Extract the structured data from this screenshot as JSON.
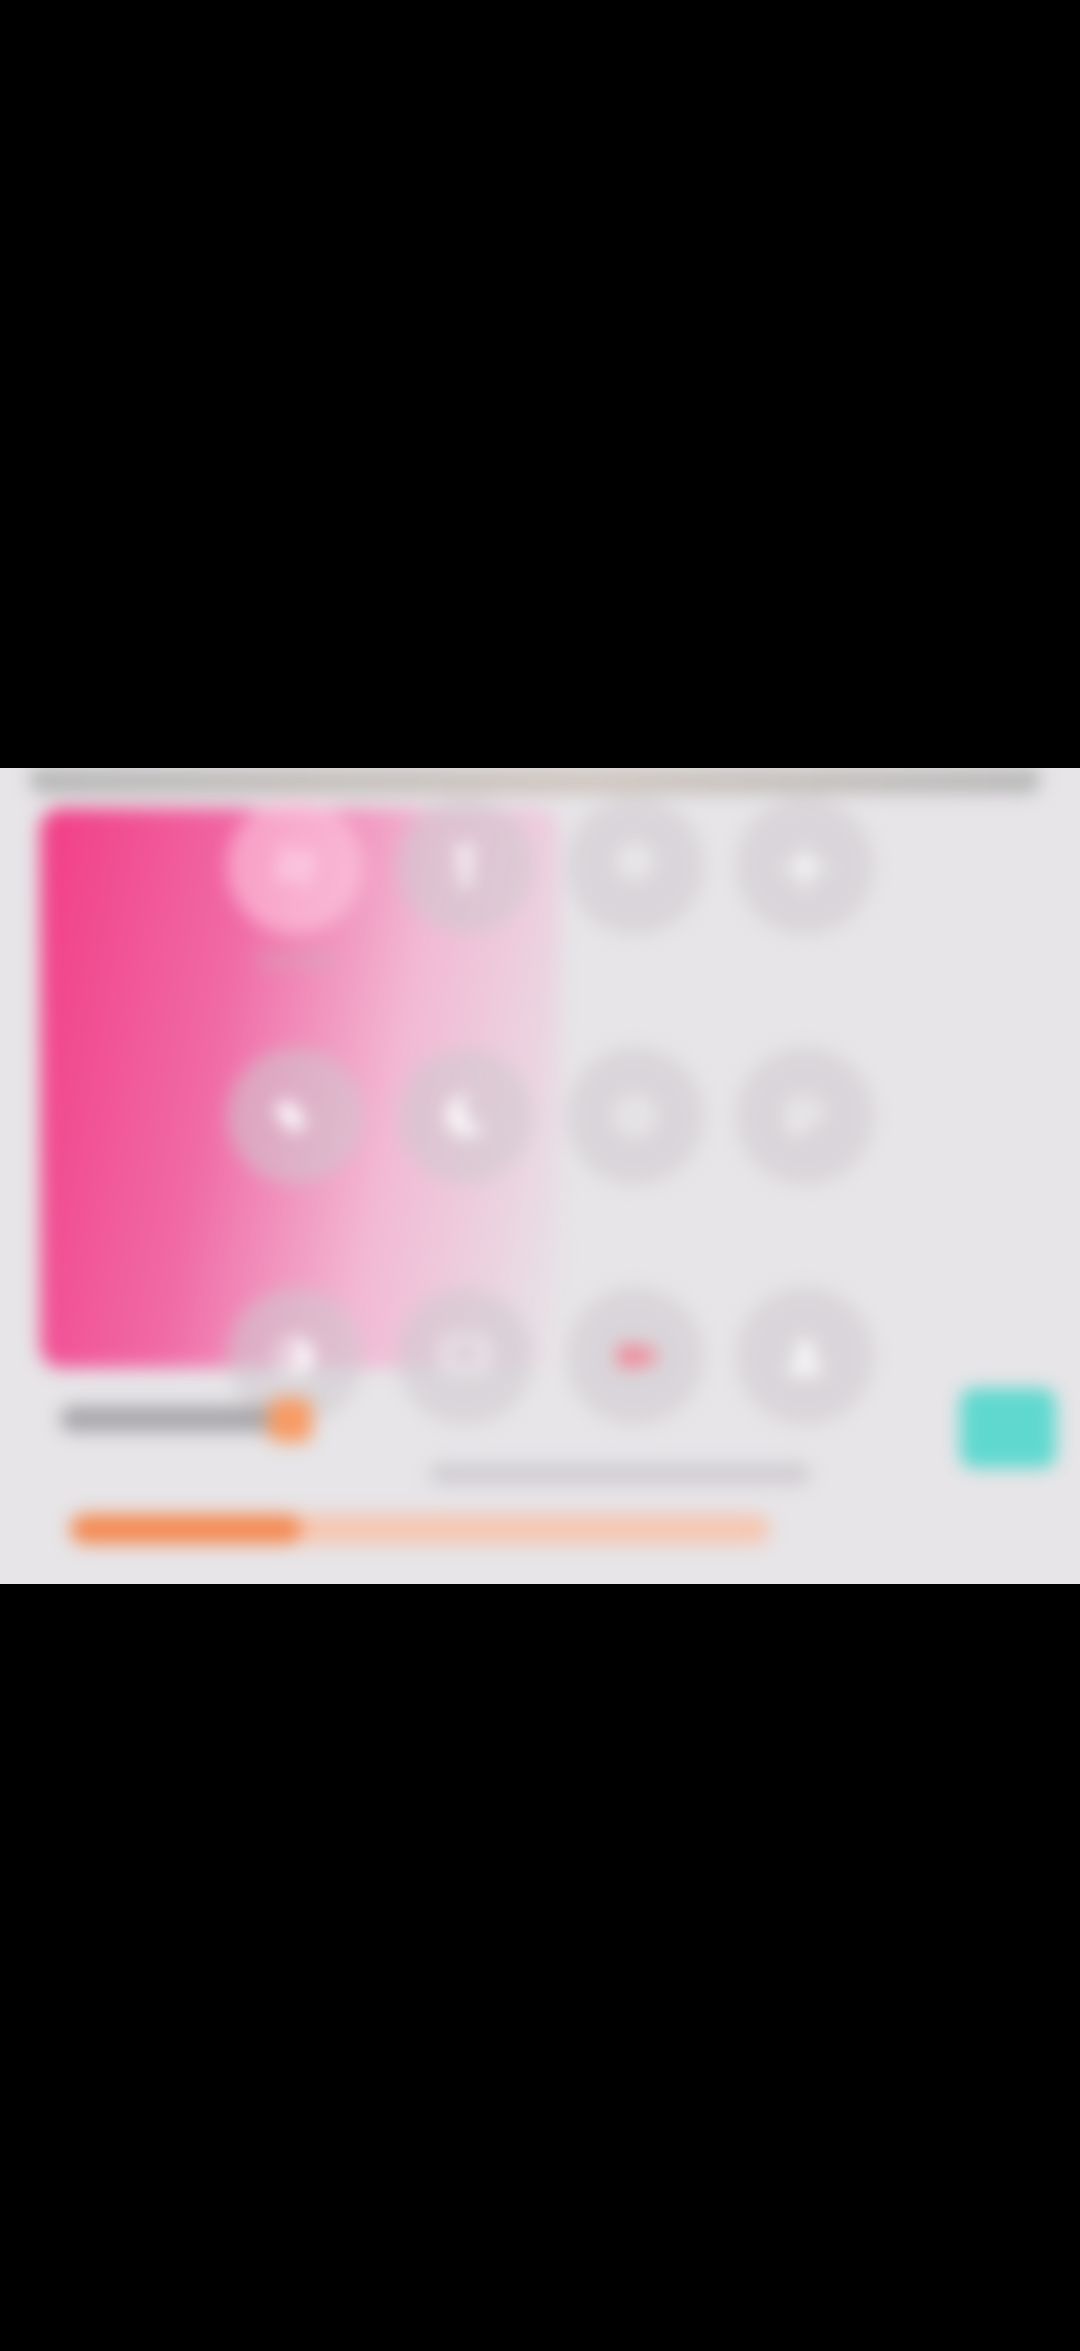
{
  "frame": {
    "accent_pink": "#f23d86",
    "accent_orange": "#f48a53",
    "accent_teal": "#5fd8cf"
  },
  "quick_settings": {
    "tiles": [
      {
        "label": "SATMN",
        "icon": "data-arrows-icon",
        "active": true
      },
      {
        "label": "",
        "icon": "flashlight-icon",
        "active": false
      },
      {
        "label": "",
        "icon": "location-icon",
        "active": false
      },
      {
        "label": "",
        "icon": "airplane-icon",
        "active": false
      },
      {
        "label": "",
        "icon": "rotate-icon",
        "active": false
      },
      {
        "label": "",
        "icon": "moon-icon",
        "active": false
      },
      {
        "label": "",
        "icon": "hotspot-icon",
        "active": false
      },
      {
        "label": "",
        "icon": "nfc-icon",
        "active": false
      },
      {
        "label": "",
        "icon": "contrast-icon",
        "active": false
      },
      {
        "label": "",
        "icon": "screen-cast-icon",
        "active": false
      },
      {
        "label": "",
        "icon": "screen-record-icon",
        "active": false
      },
      {
        "label": "",
        "icon": "user-icon",
        "active": false
      }
    ]
  },
  "brightness": {
    "level": 0.24
  },
  "progress": {
    "fraction": 0.33
  }
}
